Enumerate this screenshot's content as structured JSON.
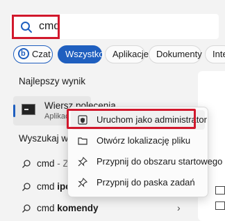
{
  "search": {
    "query": "cmd"
  },
  "filters": [
    {
      "label": "Czat"
    },
    {
      "label": "Wszystko"
    },
    {
      "label": "Aplikacje"
    },
    {
      "label": "Dokumenty"
    },
    {
      "label": "Inte"
    }
  ],
  "best_match": {
    "title": "Najlepszy wynik",
    "name": "Wiersz polecenia",
    "type": "Aplikacja"
  },
  "web_search": {
    "title": "Wyszukaj w si",
    "items": [
      {
        "query": "cmd",
        "suffix": " - Zob"
      },
      {
        "query": "cmd ",
        "bold": "ipco"
      },
      {
        "query": "cmd ",
        "bold": "komendy"
      }
    ]
  },
  "context_menu": {
    "items": [
      {
        "label": "Uruchom jako administrator",
        "icon": "shield-icon"
      },
      {
        "label": "Otwórz lokalizację pliku",
        "icon": "folder-icon"
      },
      {
        "label": "Przypnij do obszaru startowego",
        "icon": "pin-icon"
      },
      {
        "label": "Przypnij do paska zadań",
        "icon": "pin-icon"
      }
    ]
  },
  "colors": {
    "accent": "#1f5fbf",
    "highlight": "#d1182c"
  }
}
